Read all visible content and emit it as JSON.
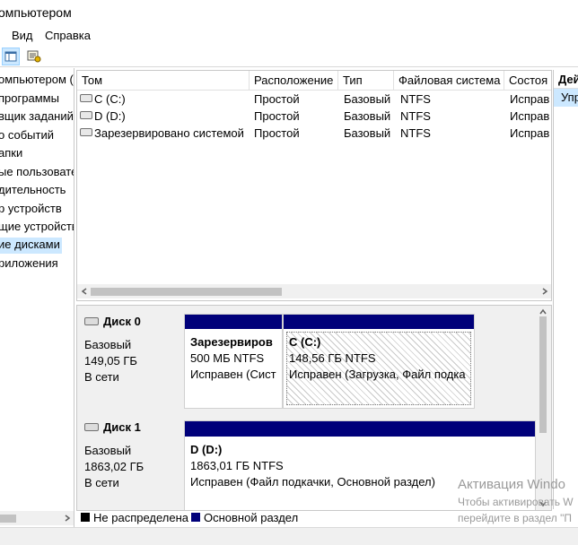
{
  "window": {
    "title": "омпьютером"
  },
  "menu": {
    "items": [
      "Вид",
      "Справка"
    ]
  },
  "tree": {
    "items": [
      {
        "label": "омпьютером (л",
        "selected": false
      },
      {
        "label": "программы",
        "selected": false
      },
      {
        "label": "вщик заданий",
        "selected": false
      },
      {
        "label": "о событий",
        "selected": false
      },
      {
        "label": "апки",
        "selected": false
      },
      {
        "label": "ые пользовате",
        "selected": false
      },
      {
        "label": "дительность",
        "selected": false
      },
      {
        "label": "р устройств",
        "selected": false
      },
      {
        "label": "щие устройств",
        "selected": false
      },
      {
        "label": "ие дисками",
        "selected": true
      },
      {
        "label": "риложения",
        "selected": false
      }
    ]
  },
  "volumes": {
    "columns": [
      "Том",
      "Расположение",
      "Тип",
      "Файловая система",
      "Состоя"
    ],
    "rows": [
      {
        "name": "C (C:)",
        "layout": "Простой",
        "type": "Базовый",
        "fs": "NTFS",
        "status": "Исправ"
      },
      {
        "name": "D (D:)",
        "layout": "Простой",
        "type": "Базовый",
        "fs": "NTFS",
        "status": "Исправ"
      },
      {
        "name": "Зарезервировано системой",
        "layout": "Простой",
        "type": "Базовый",
        "fs": "NTFS",
        "status": "Исправ"
      }
    ]
  },
  "disks": [
    {
      "name": "Диск 0",
      "type": "Базовый",
      "size": "149,05 ГБ",
      "state": "В сети",
      "partitions": [
        {
          "name": "Зарезервиров",
          "size": "500 МБ NTFS",
          "status": "Исправен (Сист"
        },
        {
          "name": "C  (C:)",
          "size": "148,56 ГБ NTFS",
          "status": "Исправен (Загрузка, Файл подка"
        }
      ]
    },
    {
      "name": "Диск 1",
      "type": "Базовый",
      "size": "1863,02 ГБ",
      "state": "В сети",
      "partitions": [
        {
          "name": "D  (D:)",
          "size": "1863,01 ГБ NTFS",
          "status": "Исправен (Файл подкачки, Основной раздел)"
        }
      ]
    }
  ],
  "legend": [
    {
      "label": "Не распределена",
      "color": "#000000"
    },
    {
      "label": "Основной раздел",
      "color": "#00007a"
    }
  ],
  "actions": {
    "header": "Дей",
    "item": "Упр"
  },
  "watermark": {
    "line1": "Активация Windo",
    "line2": "Чтобы активировать W",
    "line3": "перейдите в раздел \"П"
  }
}
